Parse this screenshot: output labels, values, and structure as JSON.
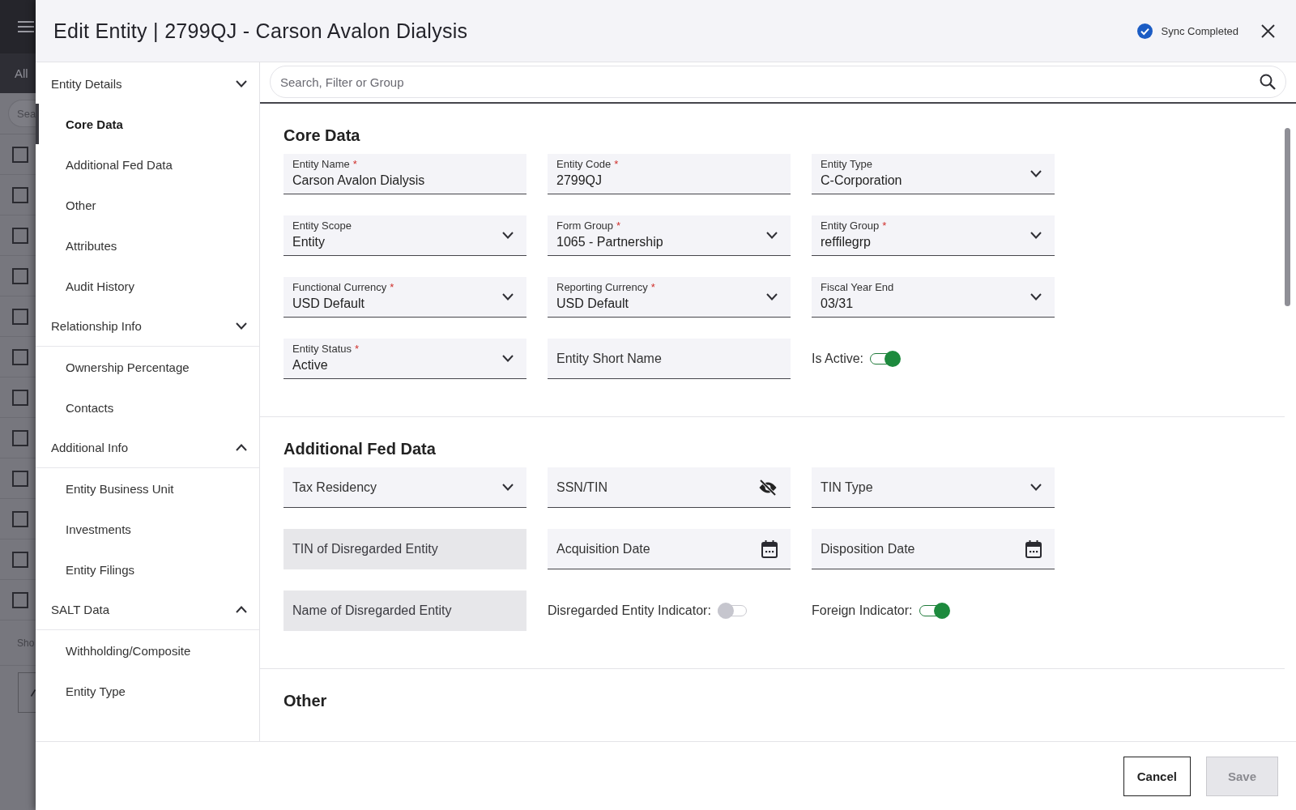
{
  "background_app": {
    "tab_label": "All",
    "search": {
      "placeholder": "Sea"
    },
    "rows": [
      {
        "checked": false
      },
      {
        "checked": false
      },
      {
        "checked": false
      },
      {
        "checked": false
      },
      {
        "checked": false
      },
      {
        "checked": false
      },
      {
        "checked": false
      },
      {
        "checked": false
      },
      {
        "checked": false
      },
      {
        "checked": false
      },
      {
        "checked": false
      },
      {
        "checked": false
      }
    ],
    "footer_text": "Sho"
  },
  "dialog": {
    "title": "Edit Entity | 2799QJ - Carson Avalon Dialysis",
    "sync_status": "Sync Completed",
    "sidebar": {
      "groups": [
        {
          "label": "Entity Details",
          "expanded": false,
          "items": [
            {
              "label": "Core Data",
              "selected": true
            },
            {
              "label": "Additional Fed Data",
              "selected": false
            },
            {
              "label": "Other",
              "selected": false
            },
            {
              "label": "Attributes",
              "selected": false
            },
            {
              "label": "Audit History",
              "selected": false
            }
          ]
        },
        {
          "label": "Relationship Info",
          "expanded": false,
          "items": [
            {
              "label": "Ownership Percentage",
              "selected": false
            },
            {
              "label": "Contacts",
              "selected": false
            }
          ]
        },
        {
          "label": "Additional Info",
          "expanded": true,
          "items": [
            {
              "label": "Entity Business Unit",
              "selected": false
            },
            {
              "label": "Investments",
              "selected": false
            },
            {
              "label": "Entity Filings",
              "selected": false
            }
          ]
        },
        {
          "label": "SALT Data",
          "expanded": true,
          "items": [
            {
              "label": "Withholding/Composite",
              "selected": false
            },
            {
              "label": "Entity Type",
              "selected": false
            }
          ]
        }
      ]
    },
    "search": {
      "placeholder": "Search, Filter or Group"
    },
    "sections": [
      {
        "title": "Core Data",
        "fields": [
          {
            "kind": "text",
            "label": "Entity Name",
            "required_mark": "*",
            "value": "Carson Avalon Dialysis",
            "disabled": false
          },
          {
            "kind": "text",
            "label": "Entity Code",
            "required_mark": "*",
            "value": "2799QJ",
            "disabled": false
          },
          {
            "kind": "select",
            "label": "Entity Type",
            "value": "C-Corporation",
            "disabled": false
          },
          {
            "kind": "select",
            "label": "Entity Scope",
            "value": "Entity",
            "disabled": false
          },
          {
            "kind": "select",
            "label": "Form Group",
            "required_mark": "*",
            "value": "1065 - Partnership",
            "disabled": false
          },
          {
            "kind": "select",
            "label": "Entity Group",
            "required_mark": "*",
            "value": "reffilegrp",
            "disabled": false
          },
          {
            "kind": "select",
            "label": "Functional Currency",
            "required_mark": "*",
            "value": "USD Default",
            "disabled": false
          },
          {
            "kind": "select",
            "label": "Reporting Currency",
            "required_mark": "*",
            "value": "USD Default",
            "disabled": false
          },
          {
            "kind": "select",
            "label": "Fiscal Year End",
            "value": "03/31",
            "disabled": false
          },
          {
            "kind": "select",
            "label": "Entity Status",
            "required_mark": "*",
            "value": "Active",
            "disabled": false
          },
          {
            "kind": "text",
            "placeholder": "Entity Short Name",
            "disabled": false
          },
          {
            "kind": "toggle",
            "label": "Is Active:",
            "on": true,
            "disabled": false
          }
        ]
      },
      {
        "title": "Additional Fed Data",
        "fields": [
          {
            "kind": "select",
            "placeholder": "Tax Residency",
            "disabled": false
          },
          {
            "kind": "secret",
            "placeholder": "SSN/TIN",
            "disabled": false
          },
          {
            "kind": "select",
            "placeholder": "TIN Type",
            "disabled": false
          },
          {
            "kind": "text",
            "placeholder": "TIN of Disregarded Entity",
            "disabled": true
          },
          {
            "kind": "date",
            "placeholder": "Acquisition Date",
            "disabled": false
          },
          {
            "kind": "date",
            "placeholder": "Disposition Date",
            "disabled": false
          },
          {
            "kind": "text",
            "placeholder": "Name of Disregarded Entity",
            "disabled": true
          },
          {
            "kind": "toggle",
            "label": "Disregarded Entity Indicator:",
            "on": false,
            "disabled": false
          },
          {
            "kind": "toggle",
            "label": "Foreign Indicator:",
            "on": true,
            "disabled": false
          }
        ]
      },
      {
        "title": "Other"
      }
    ],
    "buttons": [
      {
        "kind": "cancel",
        "label": "Cancel",
        "disabled": false
      },
      {
        "kind": "save",
        "label": "Save",
        "disabled": true
      }
    ]
  }
}
